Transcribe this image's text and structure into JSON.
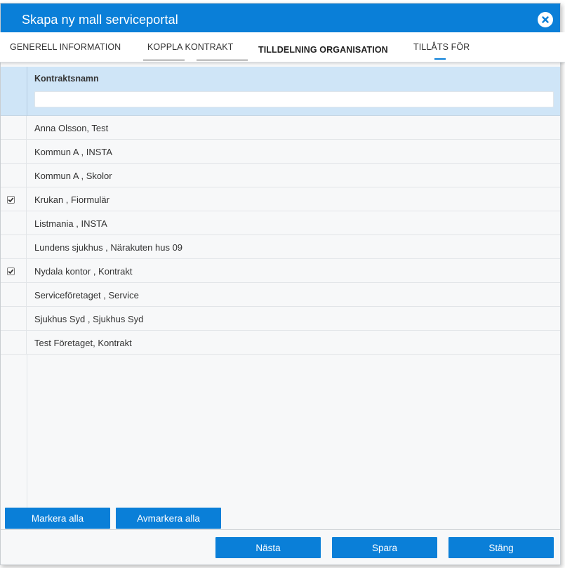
{
  "dialog": {
    "title": "Skapa ny mall serviceportal"
  },
  "tabs": [
    {
      "label": "Generell information",
      "active": false
    },
    {
      "label": "Koppla kontrakt",
      "active": false
    },
    {
      "label": "Tilldelning organisation",
      "active": true
    },
    {
      "label": "Tillåts för",
      "active": false
    }
  ],
  "grid": {
    "column_header": "Kontraktsnamn",
    "filter_value": "",
    "rows": [
      {
        "name": "Anna Olsson, Test",
        "checked": false
      },
      {
        "name": "Kommun A , INSTA",
        "checked": false
      },
      {
        "name": "Kommun A , Skolor",
        "checked": false
      },
      {
        "name": "Krukan , Fiormulär",
        "checked": true
      },
      {
        "name": "Listmania , INSTA",
        "checked": false
      },
      {
        "name": "Lundens sjukhus , Närakuten hus 09",
        "checked": false
      },
      {
        "name": "Nydala kontor , Kontrakt",
        "checked": true
      },
      {
        "name": "Serviceföretaget , Service",
        "checked": false
      },
      {
        "name": "Sjukhus Syd , Sjukhus Syd",
        "checked": false
      },
      {
        "name": "Test Företaget, Kontrakt",
        "checked": false
      }
    ]
  },
  "selection_buttons": {
    "select_all": "Markera alla",
    "deselect_all": "Avmarkera alla"
  },
  "footer_buttons": {
    "next": "Nästa",
    "save": "Spara",
    "close": "Stäng"
  },
  "colors": {
    "accent": "#0a7fd8",
    "header_bg": "#cfe5f7"
  },
  "icons": {
    "close": "close-circle-icon",
    "checkbox": "checkbox-icon"
  }
}
